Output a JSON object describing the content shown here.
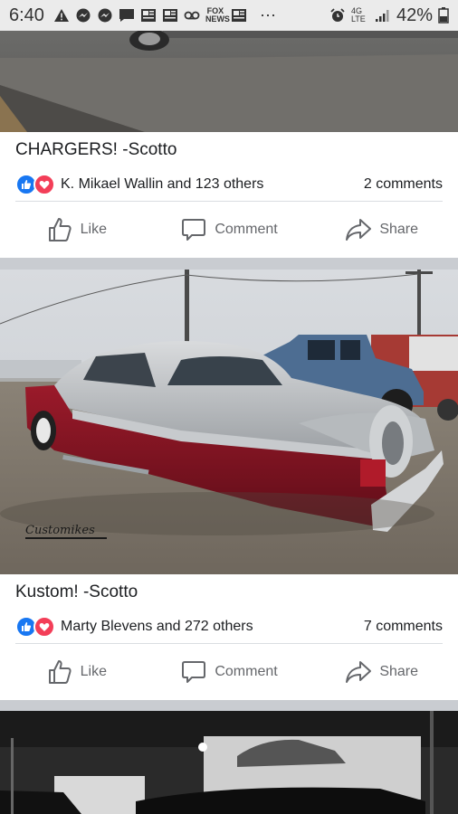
{
  "status_bar": {
    "time": "6:40",
    "left_icons": [
      "warning-icon",
      "messenger-icon",
      "messenger-icon",
      "message-icon",
      "news-icon",
      "news-icon",
      "voicemail-icon",
      "fox-news-icon",
      "news-icon",
      "more-icon"
    ],
    "fox_label": "FOX NEWS",
    "signal_label": "4G LTE",
    "battery": "42%"
  },
  "posts": [
    {
      "caption": "CHARGERS!  -Scotto",
      "reactions_text": "K. Mikael Wallin and 123 others",
      "comments": "2 comments",
      "actions": {
        "like": "Like",
        "comment": "Comment",
        "share": "Share"
      }
    },
    {
      "caption": "Kustom! -Scotto",
      "reactions_text": "Marty Blevens and 272 others",
      "comments": "7 comments",
      "watermark": "Customikes",
      "actions": {
        "like": "Like",
        "comment": "Comment",
        "share": "Share"
      }
    }
  ],
  "colors": {
    "like_blue": "#1877f2",
    "love_red": "#f33e58",
    "action_gray": "#65676b",
    "separator": "#c9ccd1"
  }
}
